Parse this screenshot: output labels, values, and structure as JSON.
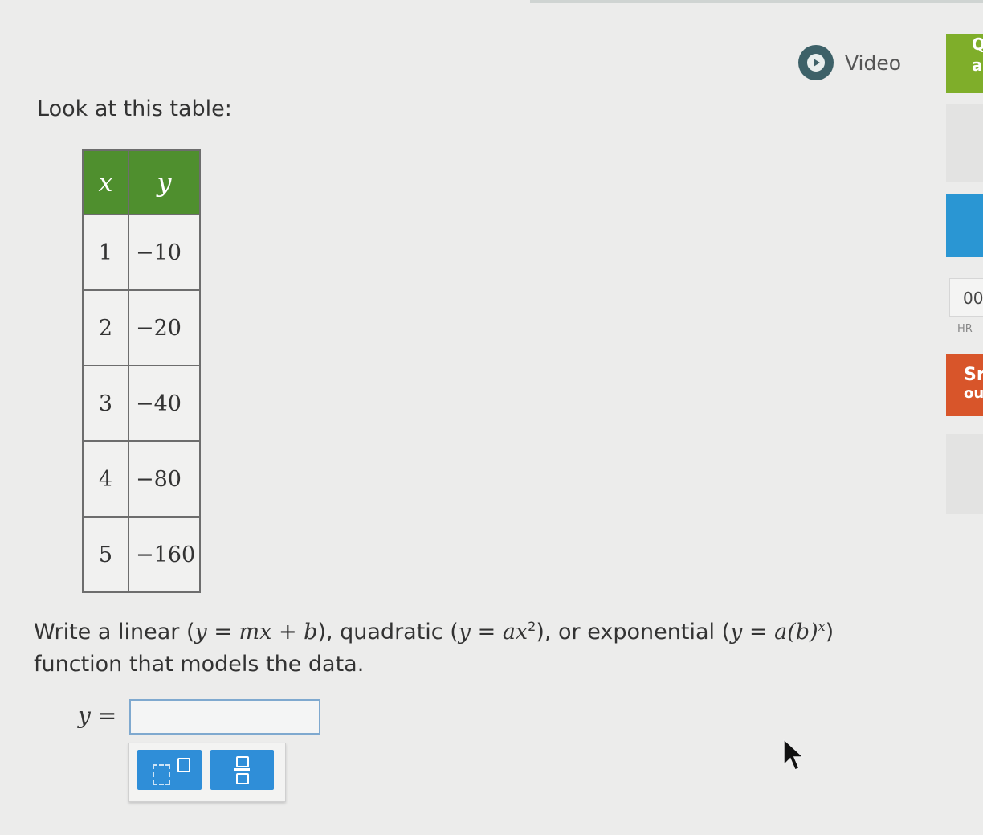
{
  "video": {
    "label": "Video",
    "icon": "play-circle-icon"
  },
  "question": {
    "prompt": "Look at this table:",
    "table": {
      "headers": [
        "x",
        "y"
      ],
      "rows": [
        [
          "1",
          "−10"
        ],
        [
          "2",
          "−20"
        ],
        [
          "3",
          "−40"
        ],
        [
          "4",
          "−80"
        ],
        [
          "5",
          "−160"
        ]
      ]
    },
    "instruction": {
      "p1": "Write a linear (",
      "linear": "y = mx + b",
      "p2": "), quadratic (",
      "quad": "y = ax",
      "quad_exp": "2",
      "p3": "), or exponential (",
      "expo": "y = a(b)",
      "expo_exp": "x",
      "p4": ")",
      "line2": "function that models the data."
    },
    "answer": {
      "label": "y =",
      "value": ""
    }
  },
  "keypad": {
    "exponent_icon": "exponent-icon",
    "fraction_icon": "fraction-icon"
  },
  "sidebar": {
    "green_text": [
      "Q",
      "a"
    ],
    "timer": "00",
    "timer_unit": "HR",
    "orange_text": [
      "Sr",
      "ou"
    ]
  },
  "colors": {
    "header_green": "#4f8f2e",
    "key_blue": "#2f8ed8",
    "accent_green": "#7fae2a",
    "accent_orange": "#d8552a",
    "accent_blue": "#2a96d3"
  }
}
